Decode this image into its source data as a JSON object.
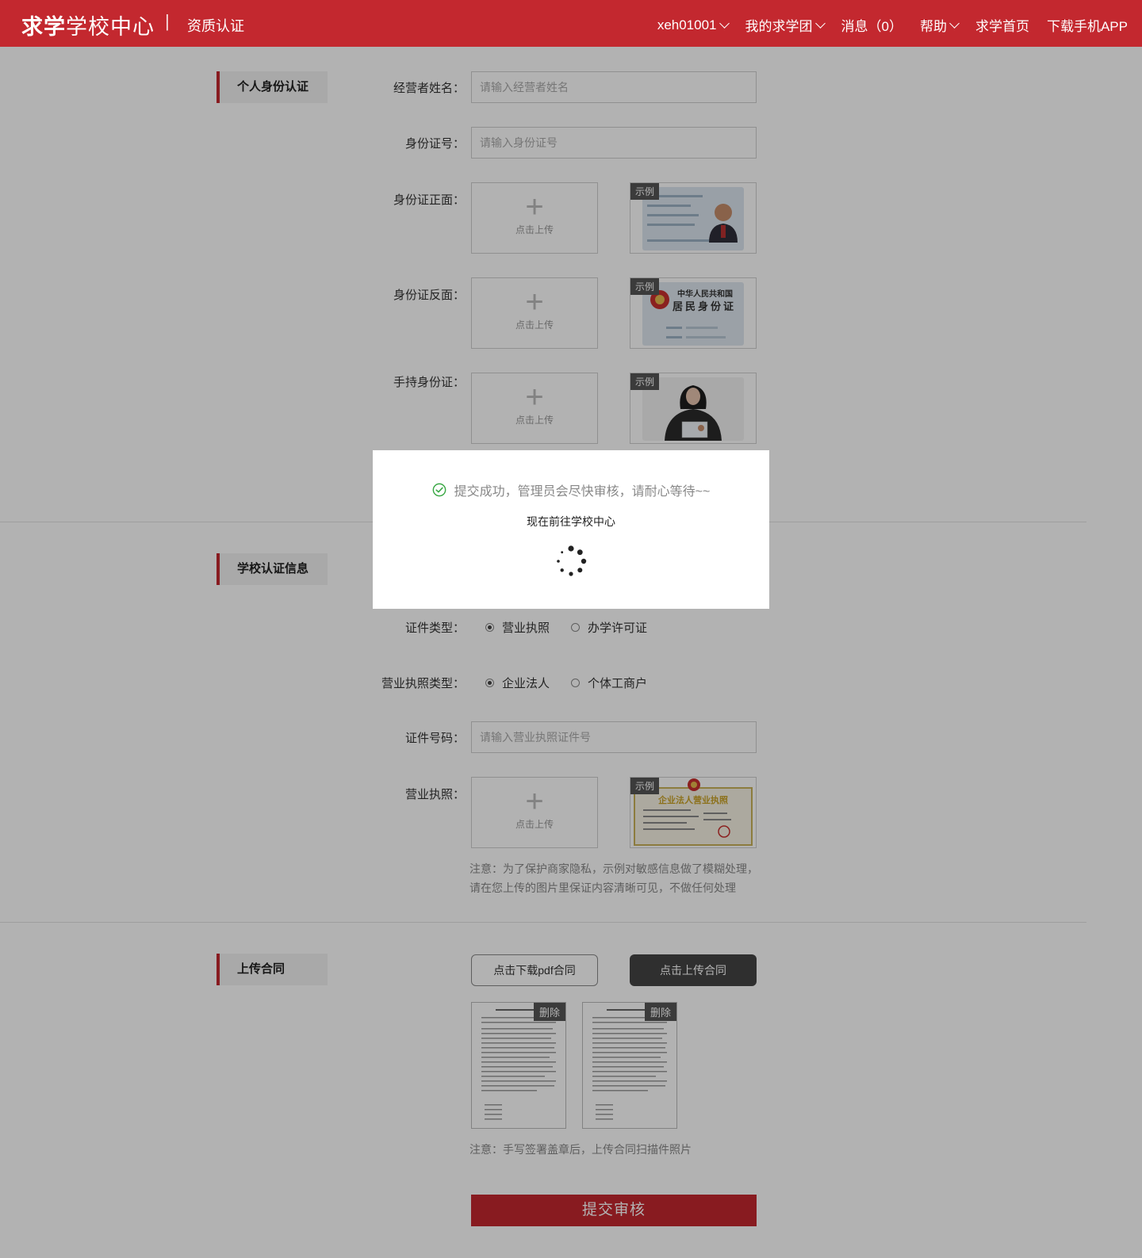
{
  "header": {
    "brand_bold": "求学",
    "brand_rest": "学校中心",
    "separator": "|",
    "subtitle": "资质认证",
    "nav": [
      {
        "label": "xeh01001",
        "dropdown": true
      },
      {
        "label": "我的求学团",
        "dropdown": true
      },
      {
        "label": "消息（0）",
        "dropdown": false
      },
      {
        "label": "帮助",
        "dropdown": true
      },
      {
        "label": "求学首页",
        "dropdown": false
      },
      {
        "label": "下载手机APP",
        "dropdown": false
      }
    ]
  },
  "personal": {
    "section_title": "个人身份认证",
    "name_label": "经营者姓名：",
    "name_placeholder": "请输入经营者姓名",
    "id_label": "身份证号：",
    "id_placeholder": "请输入身份证号",
    "front_label": "身份证正面：",
    "back_label": "身份证反面：",
    "hold_label": "手持身份证：",
    "upload_text": "点击上传",
    "upload_plus": "+",
    "example_tag": "示例",
    "back_card_line1": "中华人民共和国",
    "back_card_line2": "居民身份证"
  },
  "school": {
    "section_title": "学校认证信息",
    "cert_type_label": "证件类型：",
    "cert_type_options": [
      "营业执照",
      "办学许可证"
    ],
    "cert_type_selected": "营业执照",
    "license_type_label": "营业执照类型：",
    "license_type_options": [
      "企业法人",
      "个体工商户"
    ],
    "license_type_selected": "企业法人",
    "cert_no_label": "证件号码：",
    "cert_no_placeholder": "请输入营业执照证件号",
    "license_label": "营业执照：",
    "license_example_title": "企业法人营业执照",
    "note_line1": "注意：为了保护商家隐私，示例对敏感信息做了模糊处理，",
    "note_line2": "请在您上传的图片里保证内容清晰可见，不做任何处理"
  },
  "contract": {
    "section_title": "上传合同",
    "download_button": "点击下载pdf合同",
    "upload_button": "点击上传合同",
    "delete_label": "删除",
    "note": "注意：手写签署盖章后，上传合同扫描件照片"
  },
  "submit_label": "提交审核",
  "modal": {
    "message": "提交成功，管理员会尽快审核，请耐心等待~~",
    "sub": "现在前往学校中心"
  },
  "colors": {
    "brand_red": "#c3282f",
    "dark_button": "#444444",
    "success_green": "#3aa845"
  }
}
